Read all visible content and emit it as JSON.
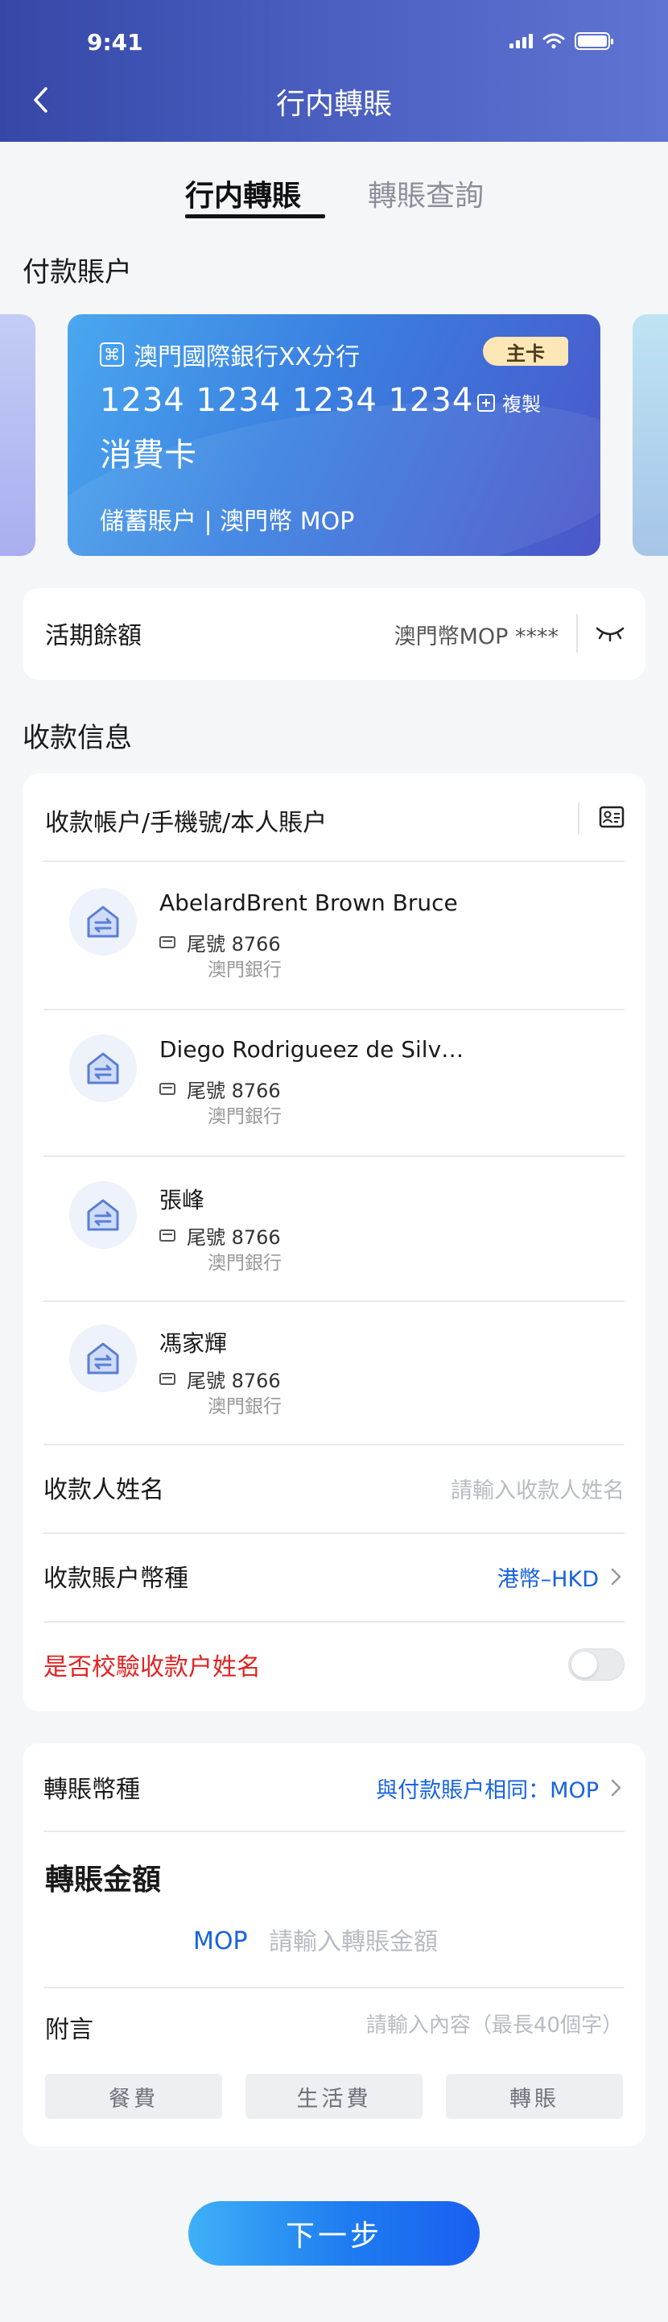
{
  "status_bar": {
    "time": "9:41"
  },
  "header": {
    "title": "行内轉賬"
  },
  "tabs": [
    {
      "label": "行内轉賬",
      "active": true
    },
    {
      "label": "轉賬查詢",
      "active": false
    }
  ],
  "payer": {
    "section_title": "付款賬户",
    "card": {
      "bank_name": "澳門國際銀行XX分行",
      "badge": "主卡",
      "number": "1234 1234 1234 1234",
      "copy_label": "複製",
      "type": "消費卡",
      "account": "儲蓄賬户 | 澳門幣 MOP"
    },
    "balance": {
      "label": "活期餘額",
      "value": "澳門幣MOP  ****"
    }
  },
  "payee": {
    "section_title": "收款信息",
    "search_label": "收款帳户/手機號/本人賬户",
    "list": [
      {
        "name": "AbelardBrent Brown Bruce",
        "tail": "尾號 8766",
        "bank": "澳門銀行"
      },
      {
        "name": "Diego Rodrigueez de Silv…",
        "tail": "尾號 8766",
        "bank": "澳門銀行"
      },
      {
        "name": "張峰",
        "tail": "尾號 8766",
        "bank": "澳門銀行"
      },
      {
        "name": "馮家輝",
        "tail": "尾號 8766",
        "bank": "澳門銀行"
      }
    ],
    "name_field": {
      "label": "收款人姓名",
      "placeholder": "請輸入收款人姓名"
    },
    "currency_field": {
      "label": "收款賬户幣種",
      "value": "港幣–HKD"
    },
    "verify_field": {
      "label": "是否校驗收款户姓名",
      "enabled": false
    }
  },
  "transfer": {
    "currency_field": {
      "label": "轉賬幣種",
      "value": "與付款賬户相同：MOP"
    },
    "amount": {
      "title": "轉賬金額",
      "currency": "MOP",
      "placeholder": "請輸入轉賬金額"
    },
    "memo": {
      "label": "附言",
      "placeholder": "請輸入內容（最長40個字）",
      "chips": [
        "餐費",
        "生活費",
        "轉賬"
      ]
    }
  },
  "next_button": "下一步",
  "colors": {
    "accent": "#1663e0",
    "header": "#4a5fc0",
    "warning": "#e02424"
  }
}
